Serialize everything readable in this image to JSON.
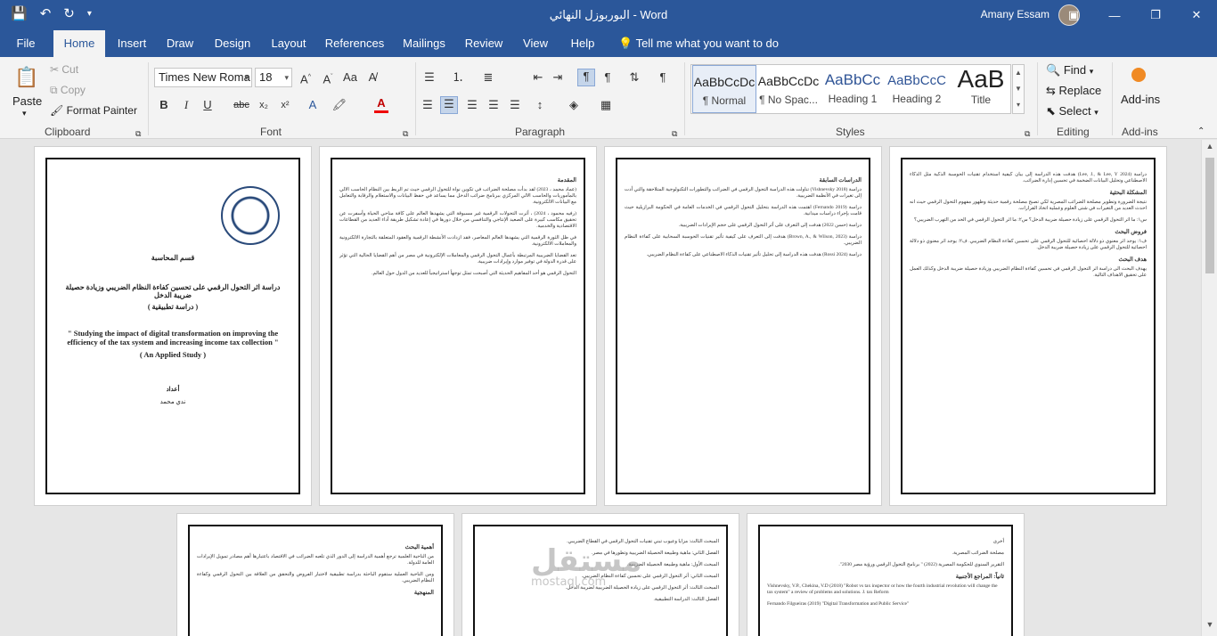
{
  "titlebar": {
    "doc_title": "البوربوزل النهائي  -  Word",
    "user_name": "Amany Essam",
    "qat": {
      "save_icon": "save-icon",
      "undo_icon": "undo-icon",
      "redo_icon": "redo-icon",
      "customize_icon": "chevron-down-icon"
    },
    "controls": {
      "ribbon_display": "ribbon-display-icon",
      "minimize": "—",
      "restore": "❐",
      "close": "✕"
    }
  },
  "tabs": [
    "File",
    "Home",
    "Insert",
    "Draw",
    "Design",
    "Layout",
    "References",
    "Mailings",
    "Review",
    "View",
    "Help"
  ],
  "tell_me": "Tell me what you want to do",
  "ribbon": {
    "clipboard": {
      "label": "Clipboard",
      "paste": "Paste",
      "cut": "Cut",
      "copy": "Copy",
      "format_painter": "Format Painter"
    },
    "font": {
      "label": "Font",
      "font_name": "Times New Roma",
      "font_size": "18",
      "bold": "B",
      "italic": "I",
      "underline": "U",
      "strike": "abc",
      "subscript": "x₂",
      "superscript": "x²"
    },
    "paragraph": {
      "label": "Paragraph"
    },
    "styles": {
      "label": "Styles",
      "items": [
        {
          "preview": "AaBbCcDc",
          "name": "¶ Normal"
        },
        {
          "preview": "AaBbCcDc",
          "name": "¶ No Spac..."
        },
        {
          "preview": "AaBbCc",
          "name": "Heading 1"
        },
        {
          "preview": "AaBbCcC",
          "name": "Heading 2"
        },
        {
          "preview": "AaB",
          "name": "Title"
        }
      ]
    },
    "editing": {
      "label": "Editing",
      "find": "Find",
      "replace": "Replace",
      "select": "Select"
    },
    "addins": {
      "label": "Add-ins",
      "button": "Add-ins"
    }
  },
  "document": {
    "cover": {
      "department": "قسم المحاسبة",
      "title_ar": "دراسة اثر التحول الرقمي على تحسين كفاءة النظام الضريبي وزيادة حصيلة ضريبة الدخل",
      "type_ar": "( دراسة تطبيقية )",
      "title_en": "\" Studying the impact of digital transformation on improving the efficiency of the tax system and increasing income tax collection \"",
      "type_en": "( An Applied Study )",
      "prepared_by": "أعداد",
      "author": "ندي محمد"
    },
    "page2": {
      "heading": "المقدمة",
      "paragraphs": [
        "(عماد محمد ، 2023) لقد بدأت مصلحة الضرائب في تكوين نواة للتحول الرقمي حيث تم الربط بين النظام الحاسب الالي بالمأموريات والحاسب الالي المركزي ببرنامج ضرائب الدخل مما يساعد في حفظ البيانات والاستعلام والرقابة والتعامل مع البيانات الالكترونية.",
        "(رفيه محمود ، 2024) ، أثرت التحولات الرقمية غير مسبوقة التي يشهدها العالم على كافة مناحي الحياة وأسفرت عن تحقيق مكاسب كبيرة على الصعيد الإنتاجي والتنافسي من خلال دورها في إعادة تشكيل طريقة أداء العديد من القطاعات الاقتصادية والخدمية.",
        "في ظل الثورة الرقمية التي يشهدها العالم المعاصر، فقد ازدادت الأنشطة الرقمية والعقود المتعلقة بالتجارة الالكترونية والمعاملات الالكترونية.",
        "تعد القضايا الضريبية المرتبطة بأعمال التحول الرقمي والمعاملات الإلكترونية في مصر من أهم القضايا الحالية التي تؤثر على قدرة الدولة في توفير موارد وإيرادات ضريبية.",
        "التحول الرقمي هو أحد المفاهيم الحديثة التي أصبحت تمثل توجهاً استراتيجياً للعديد من الدول حول العالم."
      ]
    },
    "page3": {
      "heading": "الدراسات السابقة",
      "paragraphs": [
        "دراسة (Vishnevsky 2018) تناولت هذه الدراسة التحول الرقمي في الضرائب والتطورات التكنولوجية المتلاحقة والتي أدت إلى تغيرات في الأنظمة الضريبية.",
        "دراسة (Fernando 2019) اهتمت هذه الدراسة بتحليل التحول الرقمي في الخدمات العامة في الحكومة البرازيلية حيث قامت بإجراء دراسات ميدانية.",
        "دراسة (حسن 2022) هدفت إلى التعرف على أثر التحول الرقمي على حجم الإيرادات الضريبية.",
        "دراسة (Brown, A., & Wilson, 2023) هدفت إلى التعرف على كيفية تأثير تقنيات الحوسبة السحابية على كفاءة النظام الضريبي.",
        "دراسة (Rossi 2024) هدفت هذه الدراسة إلى تحليل تأثير تقنيات الذكاء الاصطناعي على كفاءة النظام الضريبي."
      ]
    },
    "page4": {
      "heading_problem": "المشكلة البحثية",
      "heading_hypotheses": "فروض البحث",
      "heading_objective": "هدف البحث",
      "paragraphs": [
        "دراسة (Lee, J., & Lee, Y 2024) هدفت هذه الدراسة إلى بيان كيفية استخدام تقنيات الحوسبة الذكية مثل الذكاء الاصطناعي وتحليل البيانات الضخمة في تحسين إدارة الضرائب.",
        "نتيجة الضرورة وتطوير مصلحة الضرائب المصرية لكي تصبح مصلحة رقمية حديثة وظهور مفهوم التحول الرقمي حيث انه احدث العديد من التغيرات في شتى العلوم وعملية اتخاذ القرارات.",
        "س١: ما اثر التحول الرقمي على زيادة حصيلة ضريبة الدخل؟ س٢: ما اثر التحول الرقمي في الحد من التهرب الضريبي؟",
        "ف١: يوجد اثر معنوي ذو دلالة احصائية للتحول الرقمي على تحسين كفاءة النظام الضريبي. ف٢: يوجد اثر معنوي ذو دلالة احصائية للتحول الرقمي على زيادة حصيلة ضريبة الدخل.",
        "يهدف البحث الى دراسة اثر التحول الرقمي في تحسين كفاءة النظام الضريبي وزيادة حصيلة ضريبة الدخل وكذلك العمل على تحقيق الاهداف التالية."
      ]
    },
    "page5": {
      "heading_importance": "أهمية البحث",
      "heading_method": "المنهجية",
      "paragraphs": [
        "من الناحية العلمية ترجع أهمية الدراسة إلى الدور الذي تلعبه الضرائب في الاقتصاد باعتبارها أهم مصادر تمويل الإيرادات العامة للدولة.",
        "ومن الناحية العملية ستقوم الباحثة بدراسة تطبيقية لاختبار الفروض والتحقق من العلاقة بين التحول الرقمي وكفاءة النظام الضريبي."
      ]
    },
    "page6": {
      "paragraphs": [
        "المبحث الثالث: مزايا وعيوب تبني تقنيات التحول الرقمي في القطاع الضريبي.",
        "الفصل الثاني: ماهية وطبيعة الحصيلة الضريبية وتطورها في مصر.",
        "المبحث الأول: ماهية وطبيعة الحصيلة الضريبية.",
        "المبحث الثاني: أثر التحول الرقمي على تحسين كفاءة النظام الضريبي.",
        "المبحث الثالث: أثر التحول الرقمي على زيادة الحصيلة الضريبية لضريبة الدخل.",
        "الفصل الثالث: الدراسة التطبيقية."
      ]
    },
    "page7": {
      "heading_refs": "ثانياً: المراجع الأجنبية",
      "paragraphs": [
        "أخرى",
        "مصلحة الضرائب المصرية.",
        "التقرير السنوي للحكومة المصرية (2022) \" برنامج التحول الرقمي ورؤية مصر 2030\".",
        "Vishnevsky, V.P., Chekina, V.D (2018) \"Robot vs tax inspector or how the fourth industrial revolution will change the tax system\" a review of problems and solutions. J. tax Reform",
        "Fernando Filgueiras (2019) \"Digital Transformation and Public Service\""
      ]
    }
  },
  "watermark": {
    "line1": "مستقل",
    "line2": "mostaql.com"
  }
}
